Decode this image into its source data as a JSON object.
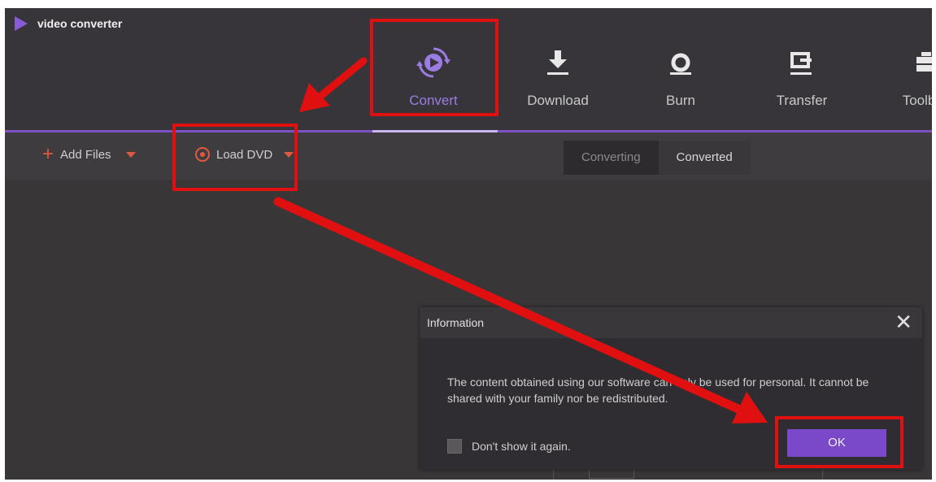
{
  "app": {
    "name": "video converter",
    "brand_color": "#8a5bd6",
    "accent_color": "#7d52c4"
  },
  "nav": {
    "active": "Convert",
    "items": [
      {
        "label": "Convert",
        "icon": "convert-play-icon"
      },
      {
        "label": "Download",
        "icon": "download-icon"
      },
      {
        "label": "Burn",
        "icon": "burn-disc-icon"
      },
      {
        "label": "Transfer",
        "icon": "transfer-icon"
      },
      {
        "label": "Toolbox",
        "icon": "toolbox-icon"
      }
    ]
  },
  "toolbar": {
    "add_files": "Add Files",
    "load_dvd": "Load DVD",
    "tabs": [
      "Converting",
      "Converted"
    ],
    "active_tab": "Converted"
  },
  "dialog": {
    "title": "Information",
    "message": "The content obtained using our software can only be used for personal. It cannot be shared with your family nor be redistributed.",
    "checkbox_label": "Don't show it again.",
    "ok": "OK",
    "close_icon": "close-icon"
  },
  "annotations": {
    "highlight_color": "#e01010"
  }
}
